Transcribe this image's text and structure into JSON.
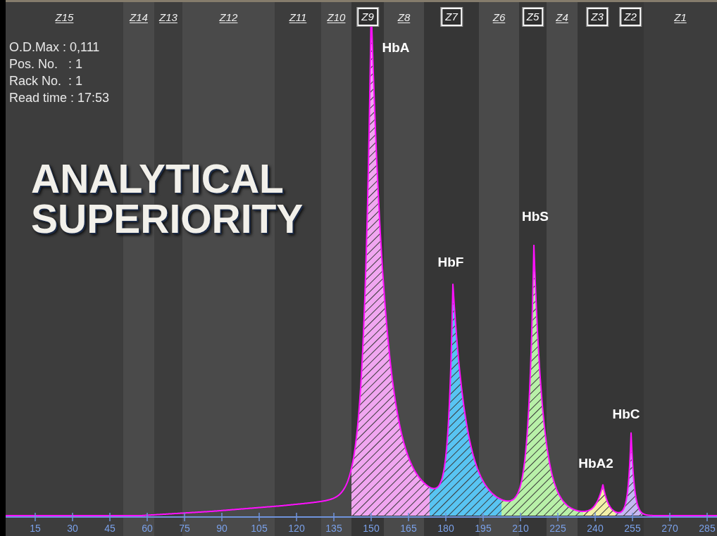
{
  "info": [
    "O.D.Max : 0,111",
    "Pos. No.   : 1",
    "Rack No.  : 1",
    "Read time : 17:53"
  ],
  "headline": "ANALYTICAL SUPERIORITY",
  "zones": [
    {
      "label": "Z15",
      "boxed": false
    },
    {
      "label": "Z14",
      "boxed": false
    },
    {
      "label": "Z13",
      "boxed": false
    },
    {
      "label": "Z12",
      "boxed": false
    },
    {
      "label": "Z11",
      "boxed": false
    },
    {
      "label": "Z10",
      "boxed": false
    },
    {
      "label": "Z9",
      "boxed": true
    },
    {
      "label": "Z8",
      "boxed": false
    },
    {
      "label": "Z7",
      "boxed": true
    },
    {
      "label": "Z6",
      "boxed": false
    },
    {
      "label": "Z5",
      "boxed": true
    },
    {
      "label": "Z4",
      "boxed": false
    },
    {
      "label": "Z3",
      "boxed": true
    },
    {
      "label": "Z2",
      "boxed": true
    },
    {
      "label": "Z1",
      "boxed": false
    }
  ],
  "peaks": [
    {
      "label": "HbA",
      "color": "#f0a6f0"
    },
    {
      "label": "HbF",
      "color": "#58c4f2"
    },
    {
      "label": "HbS",
      "color": "#b8f0a8"
    },
    {
      "label": "HbA2",
      "color": "#f2f0a8"
    },
    {
      "label": "HbC",
      "color": "#c4b8f2"
    }
  ],
  "axis_labels": [
    "15",
    "30",
    "45",
    "60",
    "75",
    "90",
    "105",
    "120",
    "135",
    "150",
    "165",
    "180",
    "195",
    "210",
    "225",
    "240",
    "255",
    "270",
    "285"
  ]
}
